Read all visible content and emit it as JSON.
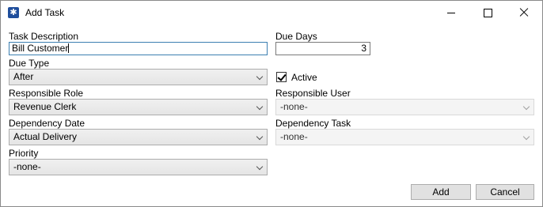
{
  "window": {
    "title": "Add Task",
    "icon": "gear-icon"
  },
  "form": {
    "task_description": {
      "label": "Task Description",
      "value": "Bill Customer"
    },
    "due_days": {
      "label": "Due Days",
      "value": "3"
    },
    "due_type": {
      "label": "Due Type",
      "value": "After"
    },
    "active": {
      "label": "Active",
      "checked": true
    },
    "responsible_role": {
      "label": "Responsible Role",
      "value": "Revenue Clerk"
    },
    "responsible_user": {
      "label": "Responsible User",
      "value": "-none-"
    },
    "dependency_date": {
      "label": "Dependency Date",
      "value": "Actual Delivery"
    },
    "dependency_task": {
      "label": "Dependency Task",
      "value": "-none-"
    },
    "priority": {
      "label": "Priority",
      "value": "-none-"
    }
  },
  "actions": {
    "add_label": "Add",
    "cancel_label": "Cancel"
  }
}
